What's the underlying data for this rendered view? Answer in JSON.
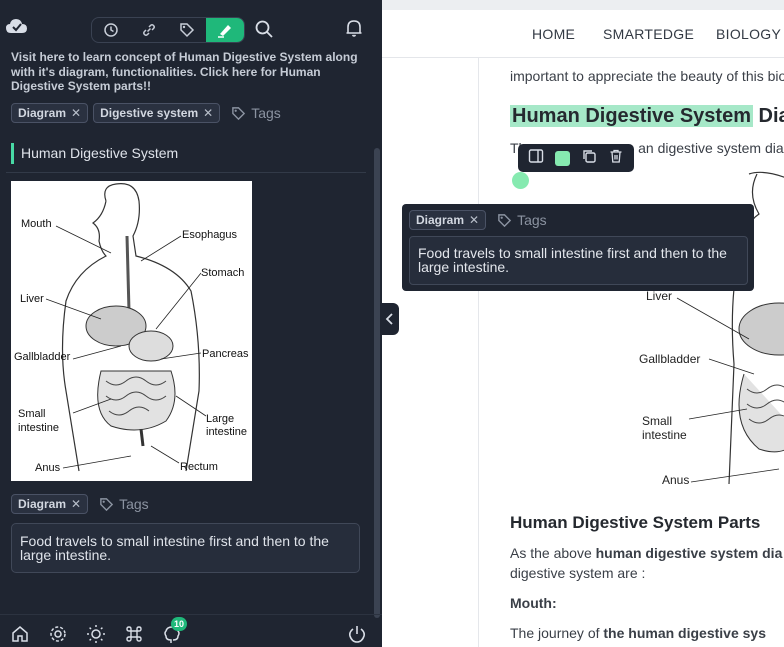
{
  "sidebar": {
    "description": "Visit here to learn concept of Human Digestive System along with it's diagram, functionalities. Click here for Human Digestive System parts!!",
    "tags_top": [
      "Diagram",
      "Digestive system"
    ],
    "tags_placeholder": "Tags",
    "heading": "Human Digestive System",
    "diagram_labels": {
      "mouth": "Mouth",
      "esophagus": "Esophagus",
      "stomach": "Stomach",
      "liver": "Liver",
      "gallbladder": "Gallbladder",
      "pancreas": "Pancreas",
      "small1": "Small",
      "small2": "intestine",
      "large1": "Large",
      "large2": "intestine",
      "anus": "Anus",
      "rectum": "Rectum"
    },
    "tags_bottom": [
      "Diagram"
    ],
    "note": "Food travels to small intestine first and then to the large intestine.",
    "badge_count": "10"
  },
  "nav": {
    "home": "HOME",
    "smartedge": "SMARTEDGE",
    "biology": "BIOLOGY"
  },
  "content": {
    "line_top": "important to appreciate the beauty of this bio",
    "title_highlight": "Human Digestive System",
    "title_rest": " Dia",
    "subline_a": "The",
    "subline_b": "an digestive system diag",
    "fig_labels": {
      "liver": "Liver",
      "gallbladder": "Gallbladder",
      "small1": "Small",
      "small2": "intestine",
      "anus": "Anus"
    },
    "h3": "Human Digestive System Parts",
    "para1_a": "As the above ",
    "para1_b": "human digestive system dia",
    "para2": "digestive system are :",
    "mouth_label": "Mouth:",
    "para3_a": "The journey of ",
    "para3_b": "the human digestive sys"
  },
  "popover": {
    "tags": [
      "Diagram"
    ],
    "tags_placeholder": "Tags",
    "note": "Food travels to small intestine first and then to the large intestine."
  },
  "colors": {
    "sidebar_bg": "#1f2531",
    "accent": "#1fb87a",
    "highlight": "#a6e8c8"
  }
}
